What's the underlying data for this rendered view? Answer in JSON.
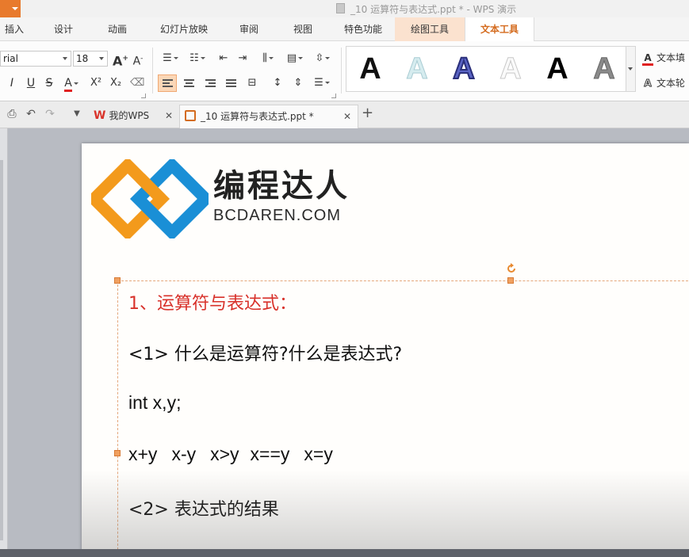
{
  "window": {
    "title": "_10 运算符与表达式.ppt * - WPS 演示"
  },
  "menu_tabs": [
    {
      "label": "插入"
    },
    {
      "label": "设计"
    },
    {
      "label": "动画"
    },
    {
      "label": "幻灯片放映"
    },
    {
      "label": "审阅"
    },
    {
      "label": "视图"
    },
    {
      "label": "特色功能"
    },
    {
      "label": "绘图工具"
    },
    {
      "label": "文本工具"
    }
  ],
  "ribbon": {
    "font_name": "rial",
    "font_size": "18",
    "grow_font": "A",
    "shrink_font": "A",
    "italic": "I",
    "underline": "U",
    "strike": "S",
    "font_color": "A",
    "superscript": "X²",
    "subscript": "X₂",
    "wordart_letter": "A",
    "fill_label": "文本填",
    "outline_label": "文本轮"
  },
  "wordart_styles": [
    {
      "name": "black-solid",
      "color": "#111111"
    },
    {
      "name": "light-teal",
      "color": "#cfe6ea"
    },
    {
      "name": "blue-outline",
      "color": "#4a55b8"
    },
    {
      "name": "white-outline",
      "color": "#f2f2f2"
    },
    {
      "name": "black-bold",
      "color": "#000000"
    },
    {
      "name": "grey-gradient",
      "color": "#8a8a8a"
    }
  ],
  "doc_tabs": [
    {
      "label": "我的WPS",
      "active": false
    },
    {
      "label": "_10 运算符与表达式.ppt *",
      "active": true
    }
  ],
  "slide": {
    "logo_title": "编程达人",
    "logo_subtitle": "BCDAREN.COM",
    "brand_colors": {
      "orange": "#f39a1c",
      "blue": "#1a8fd6"
    },
    "lines": {
      "heading": "1、运算符与表达式：",
      "q1": "<1> 什么是运算符?什么是表达式?",
      "decl": "int x,y;",
      "expressions": [
        "x+y",
        "x-y",
        "x>y",
        "x==y",
        "x=y"
      ],
      "q2": "<2> 表达式的结果"
    }
  }
}
